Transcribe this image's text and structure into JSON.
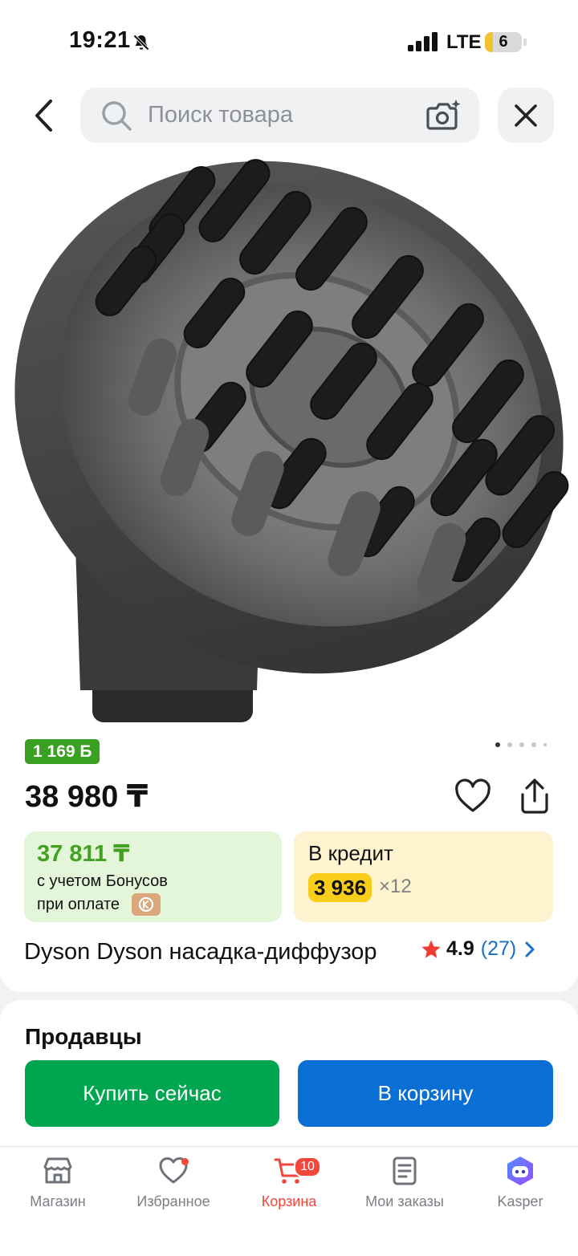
{
  "status_bar": {
    "time": "19:21",
    "network": "LTE",
    "battery": "6"
  },
  "search": {
    "placeholder": "Поиск товара"
  },
  "product": {
    "bonus_badge": "1 169 Б",
    "image_pages": 5,
    "image_active_index": 0,
    "price": "38 980 ₸",
    "bonus_price": "37 811 ₸",
    "bonus_line1": "с учетом Бонусов",
    "bonus_line2": "при оплате",
    "credit_label": "В кредит",
    "credit_amount": "3 936",
    "credit_term": "×12",
    "title": "Dyson Dyson насадка-диффузор",
    "rating": "4.9",
    "reviews": "(27)"
  },
  "sellers": {
    "title": "Продавцы"
  },
  "actions": {
    "buy_now": "Купить сейчас",
    "add_to_cart": "В корзину"
  },
  "nav": {
    "items": [
      {
        "label": "Магазин",
        "icon": "store-icon"
      },
      {
        "label": "Избранное",
        "icon": "heart-icon"
      },
      {
        "label": "Корзина",
        "icon": "cart-icon",
        "badge": "10"
      },
      {
        "label": "Мои заказы",
        "icon": "orders-icon"
      },
      {
        "label": "Kasper",
        "icon": "kasper-icon"
      }
    ]
  },
  "colors": {
    "accent_green": "#00a54f",
    "accent_blue": "#0a6fd4",
    "nav_active": "#f2473b",
    "bonus_green": "#39a021",
    "credit_yellow": "#f7cc1b"
  }
}
